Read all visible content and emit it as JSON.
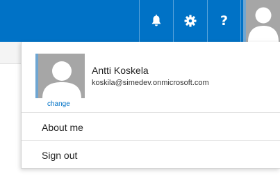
{
  "header": {
    "accent_color": "#0072c6",
    "buttons": [
      {
        "name": "notifications",
        "icon": "bell-icon"
      },
      {
        "name": "settings",
        "icon": "gear-icon"
      },
      {
        "name": "help",
        "icon": "question-icon",
        "glyph": "?"
      }
    ],
    "avatar_icon": "user-silhouette-icon"
  },
  "profile": {
    "name": "Antti Koskela",
    "email": "koskila@simedev.onmicrosoft.com",
    "change_label": "change",
    "avatar_icon": "user-silhouette-icon"
  },
  "menu": {
    "items": [
      {
        "label": "About me"
      },
      {
        "label": "Sign out"
      }
    ]
  }
}
